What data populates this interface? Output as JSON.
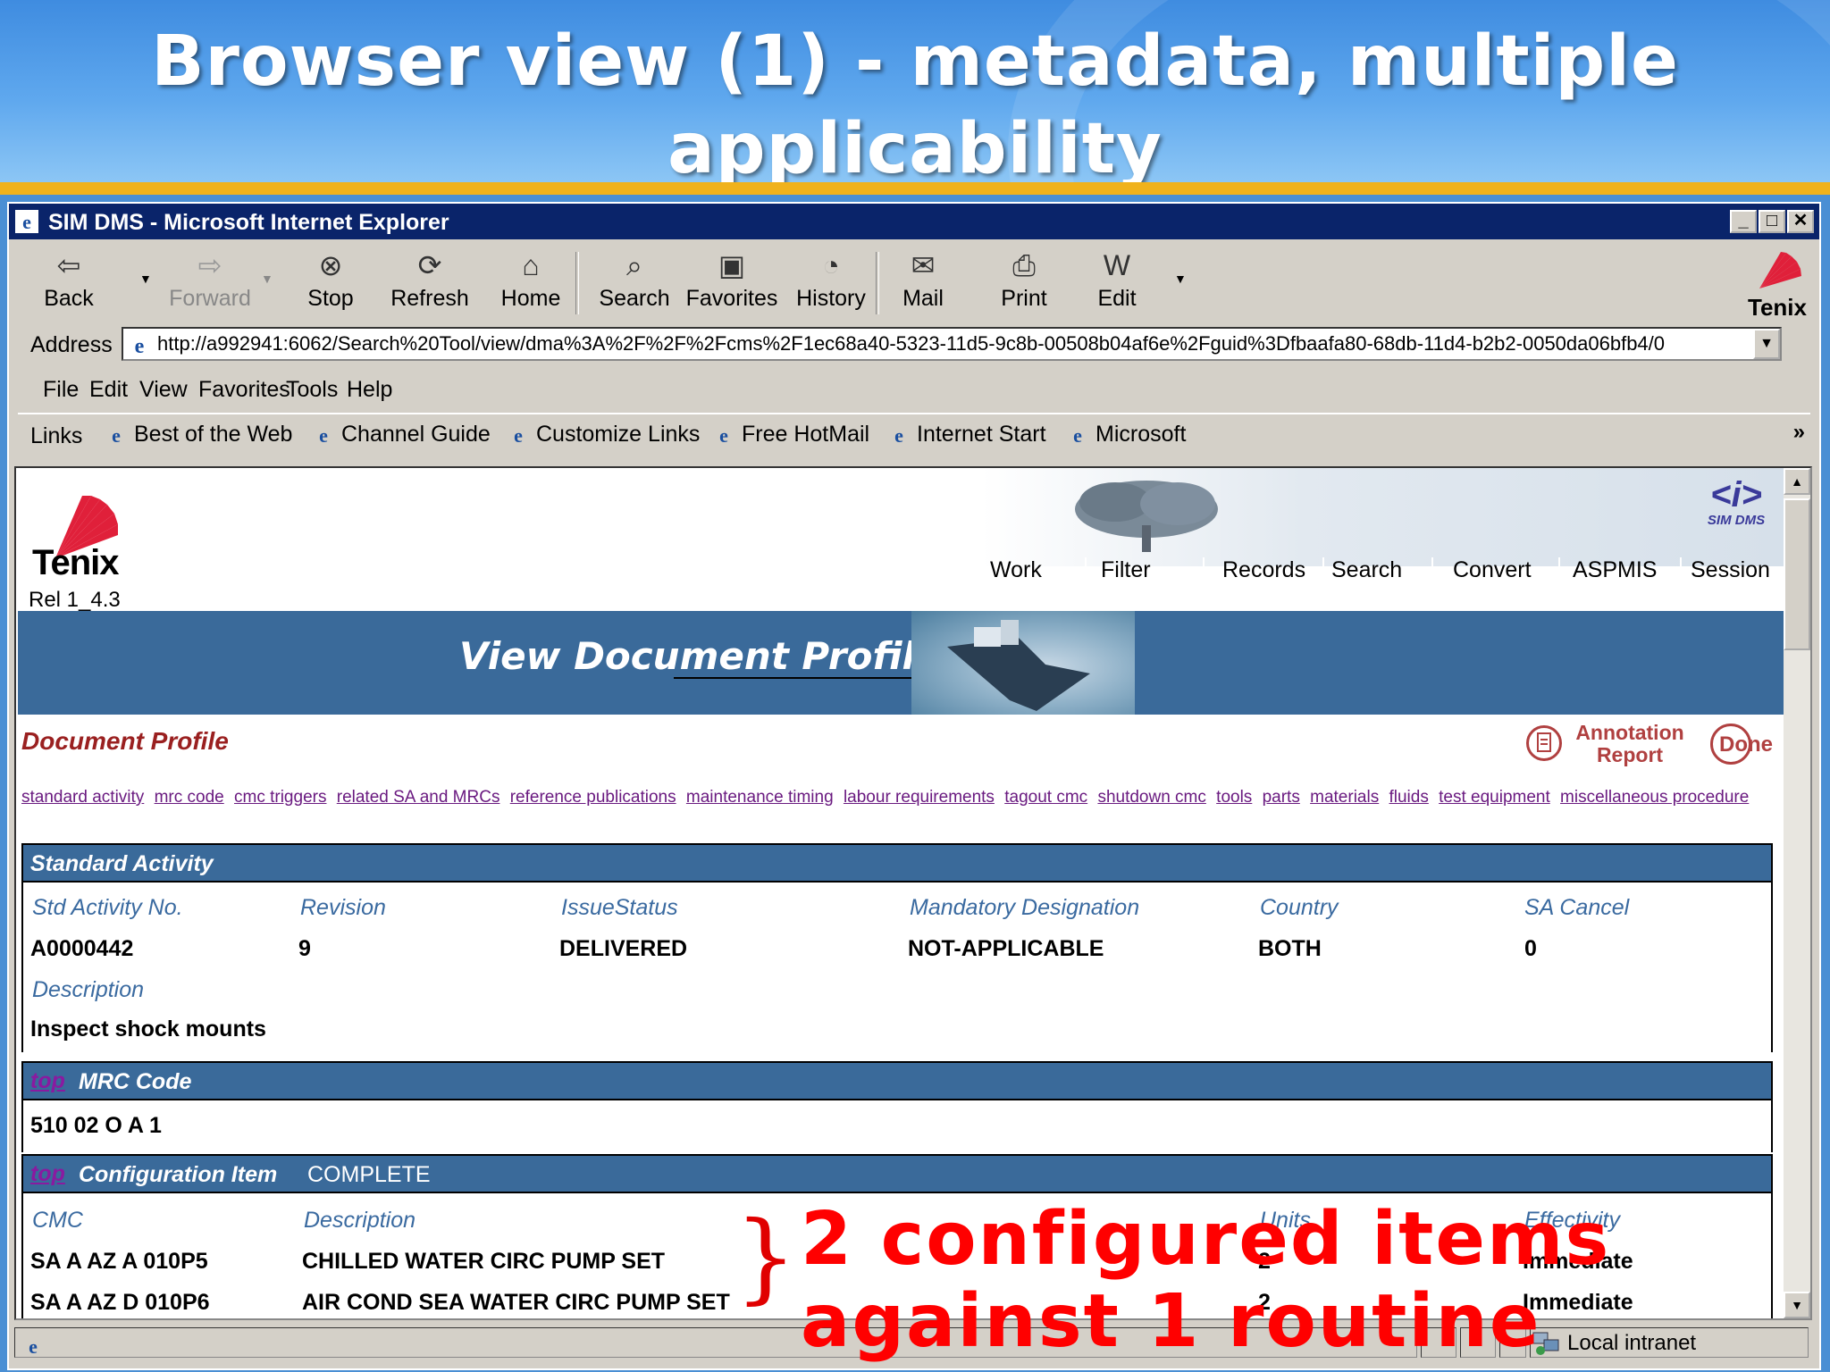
{
  "slide": {
    "title": "Browser view (1) - metadata, multiple applicability"
  },
  "window": {
    "title": "SIM DMS - Microsoft Internet Explorer",
    "minimize": "_",
    "maximize": "□",
    "close": "✕"
  },
  "toolbar": {
    "back": "Back",
    "forward": "Forward",
    "stop": "Stop",
    "refresh": "Refresh",
    "home": "Home",
    "search": "Search",
    "favorites": "Favorites",
    "history": "History",
    "mail": "Mail",
    "print": "Print",
    "edit": "Edit",
    "brand": "Tenix"
  },
  "address": {
    "label": "Address",
    "value": "http://a992941:6062/Search%20Tool/view/dma%3A%2F%2F%2Fcms%2F1ec68a40-5323-11d5-9c8b-00508b04af6e%2Fguid%3Dfbaafa80-68db-11d4-b2b2-0050da06bfb4/0"
  },
  "menu": {
    "items": [
      "File",
      "Edit",
      "View",
      "Favorites",
      "Tools",
      "Help"
    ]
  },
  "links": {
    "label": "Links",
    "items": [
      "Best of the Web",
      "Channel Guide",
      "Customize Links",
      "Free HotMail",
      "Internet Start",
      "Microsoft"
    ],
    "more": "»"
  },
  "app": {
    "brand": "Tenix",
    "release": "Rel 1_4.3",
    "logo_text": "SIM DMS",
    "logo_mark": "<i>",
    "nav": [
      "Work",
      "Filter",
      "Records",
      "Search",
      "Convert",
      "ASPMIS",
      "Session"
    ],
    "banner_title": "View Document Profile",
    "section_title": "Document Profile",
    "annotation_report": "Annotation Report",
    "done": "Done",
    "section_links": [
      "standard activity",
      "mrc code",
      "cmc triggers",
      "related SA and MRCs",
      "reference publications",
      "maintenance timing",
      "labour requirements",
      "tagout cmc",
      "shutdown cmc",
      "tools",
      "parts",
      "materials",
      "fluids",
      "test equipment",
      "miscellaneous procedure"
    ]
  },
  "standard_activity": {
    "header": "Standard Activity",
    "labels": {
      "std_no": "Std Activity No.",
      "revision": "Revision",
      "issue_status": "IssueStatus",
      "mandatory": "Mandatory Designation",
      "country": "Country",
      "sa_cancel": "SA Cancel",
      "description": "Description"
    },
    "values": {
      "std_no": "A0000442",
      "revision": "9",
      "issue_status": "DELIVERED",
      "mandatory": "NOT-APPLICABLE",
      "country": "BOTH",
      "sa_cancel": "0",
      "description": "Inspect shock mounts"
    }
  },
  "mrc": {
    "top": "top",
    "header": "MRC Code",
    "value": "510 02 O A 1"
  },
  "config": {
    "top": "top",
    "header": "Configuration Item",
    "status": "COMPLETE",
    "columns": [
      "CMC",
      "Description",
      "Units",
      "Effectivity"
    ],
    "rows": [
      {
        "cmc": "SA A AZ A 010P5",
        "description": "CHILLED WATER CIRC PUMP SET",
        "units": "2",
        "effectivity": "Immediate"
      },
      {
        "cmc": "SA A AZ D 010P6",
        "description": "AIR COND SEA WATER CIRC PUMP SET",
        "units": "2",
        "effectivity": "Immediate"
      }
    ]
  },
  "statusbar": {
    "zone": "Local intranet"
  },
  "callout": {
    "brace": "}",
    "line1": "2 configured items",
    "line2": "against 1 routine"
  },
  "colors": {
    "titlebar": "#0a246a",
    "section_bar": "#3a6a9a",
    "accent_red": "#ff0000",
    "link_purple": "#6a1a80",
    "slide_bar": "#f0b21c"
  }
}
